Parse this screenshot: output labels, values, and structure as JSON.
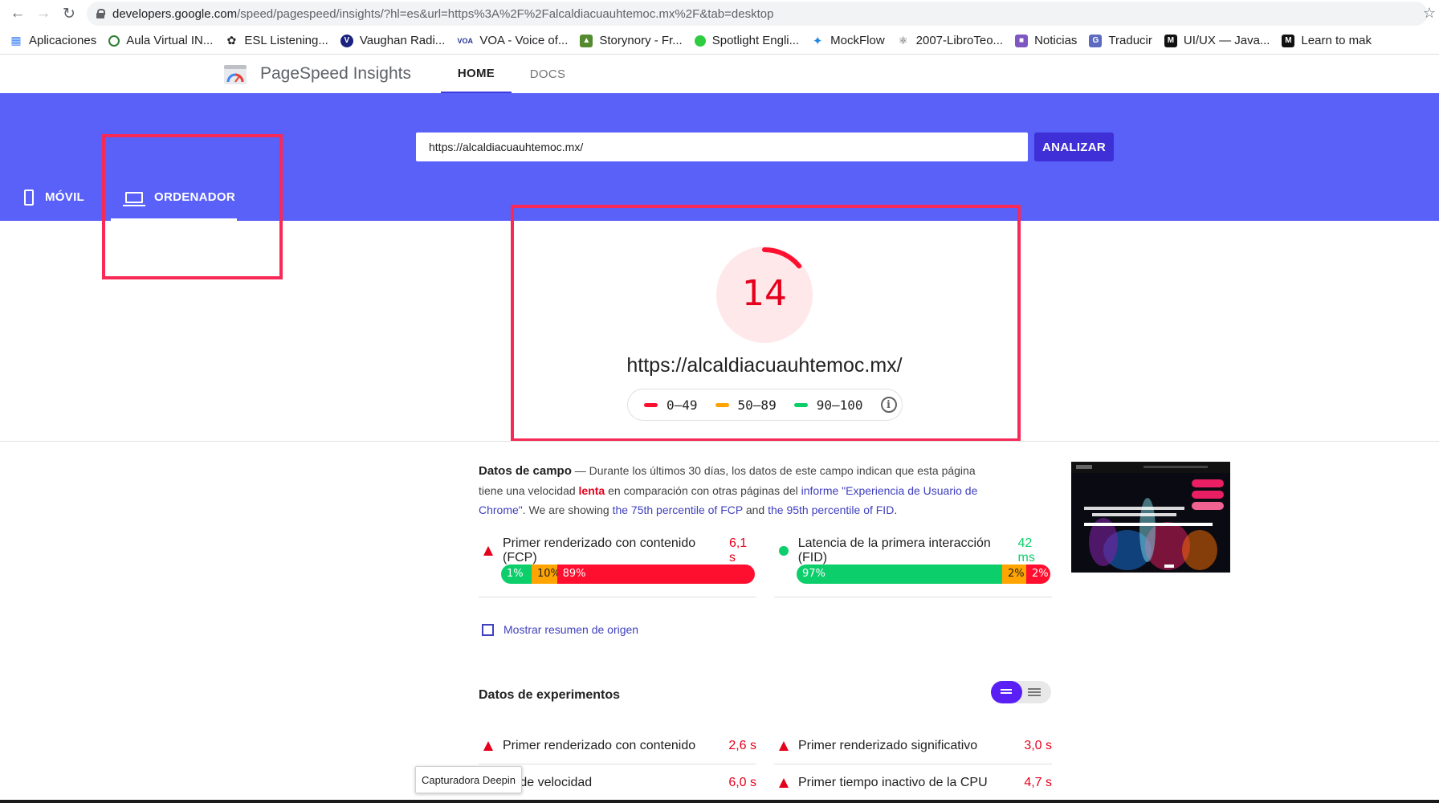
{
  "browser": {
    "url_host": "developers.google.com",
    "url_path": "/speed/pagespeed/insights/?hl=es&url=https%3A%2F%2Falcaldiacuauhtemoc.mx%2F&tab=desktop",
    "bookmarks": [
      {
        "label": "Aplicaciones",
        "icon": "apps-grid-icon",
        "color": "#4285f4"
      },
      {
        "label": "Aula Virtual IN...",
        "icon": "moodle-icon",
        "color": "#2e7d32"
      },
      {
        "label": "ESL Listening...",
        "icon": "paw-icon",
        "color": "#212121"
      },
      {
        "label": "Vaughan Radi...",
        "icon": "vaughan-icon",
        "color": "#1a237e"
      },
      {
        "label": "VOA - Voice of...",
        "icon": "voa-icon",
        "color": "#283593"
      },
      {
        "label": "Storynory - Fr...",
        "icon": "storynory-icon",
        "color": "#33691e"
      },
      {
        "label": "Spotlight Engli...",
        "icon": "spotlight-icon",
        "color": "#2ecc40"
      },
      {
        "label": "MockFlow",
        "icon": "mockflow-icon",
        "color": "#1e88e5"
      },
      {
        "label": "2007-LibroTeo...",
        "icon": "drive-icon",
        "color": "#424242"
      },
      {
        "label": "Noticias",
        "icon": "news-icon",
        "color": "#7e57c2"
      },
      {
        "label": "Traducir",
        "icon": "translate-icon",
        "color": "#5c6bc0"
      },
      {
        "label": "UI/UX — Java...",
        "icon": "medium-icon",
        "color": "#111111"
      },
      {
        "label": "Learn to mak",
        "icon": "medium-icon",
        "color": "#111111"
      }
    ]
  },
  "header": {
    "title": "PageSpeed Insights",
    "tabs": [
      {
        "label": "HOME",
        "active": true
      },
      {
        "label": "DOCS",
        "active": false
      }
    ]
  },
  "search": {
    "value": "https://alcaldiacuauhtemoc.mx/",
    "button": "ANALIZAR"
  },
  "device_tabs": [
    {
      "label": "MÓVIL",
      "icon": "phone-icon"
    },
    {
      "label": "ORDENADOR",
      "icon": "laptop-icon",
      "active": true
    }
  ],
  "score": {
    "value": "14",
    "fraction": 0.14,
    "url": "https://alcaldiacuauhtemoc.mx/",
    "legend": [
      {
        "label": "0–49",
        "color": "#ff0f2f"
      },
      {
        "label": "50–89",
        "color": "#ffa400"
      },
      {
        "label": "90–100",
        "color": "#0cce6b"
      }
    ]
  },
  "field_data": {
    "title": "Datos de campo",
    "intro": " — Durante los últimos 30 días, los datos de este campo indican que esta página tiene una velocidad ",
    "slow_word": "lenta",
    "mid": " en comparación con otras páginas del ",
    "report_link": "informe \"Experiencia de Usuario de Chrome\"",
    "showing": ". We are showing ",
    "fcp_link": "the 75th percentile of FCP",
    "and": " and ",
    "fid_link": "the 95th percentile of FID",
    "end": ".",
    "metrics": [
      {
        "label": "Primer renderizado con contenido (FCP)",
        "value": "6,1 s",
        "status": "slow",
        "distribution": [
          {
            "label": "1%",
            "pct": 1
          },
          {
            "label": "10%",
            "pct": 10
          },
          {
            "label": "89%",
            "pct": 89
          }
        ]
      },
      {
        "label": "Latencia de la primera interacción (FID)",
        "value": "42 ms",
        "status": "fast",
        "distribution": [
          {
            "label": "97%",
            "pct": 97
          },
          {
            "label": "2%",
            "pct": 2
          },
          {
            "label": "2%",
            "pct": 2
          }
        ]
      }
    ],
    "origin_toggle": "Mostrar resumen de origen"
  },
  "lab_data": {
    "title": "Datos de experimentos",
    "rows": [
      {
        "label": "Primer renderizado con contenido",
        "value": "2,6 s"
      },
      {
        "label": "Primer renderizado significativo",
        "value": "3,0 s"
      },
      {
        "label": "ce de velocidad",
        "value": "6,0 s"
      },
      {
        "label": "Primer tiempo inactivo de la CPU",
        "value": "4,7 s"
      }
    ]
  },
  "tooltip": "Capturadora Deepin",
  "colors": {
    "brand_blue": "#5961f9",
    "button": "#3f2fd6",
    "fail": "#e5001c",
    "pass": "#0cce6b",
    "average": "#ffa400",
    "annotation": "#f72a57"
  }
}
